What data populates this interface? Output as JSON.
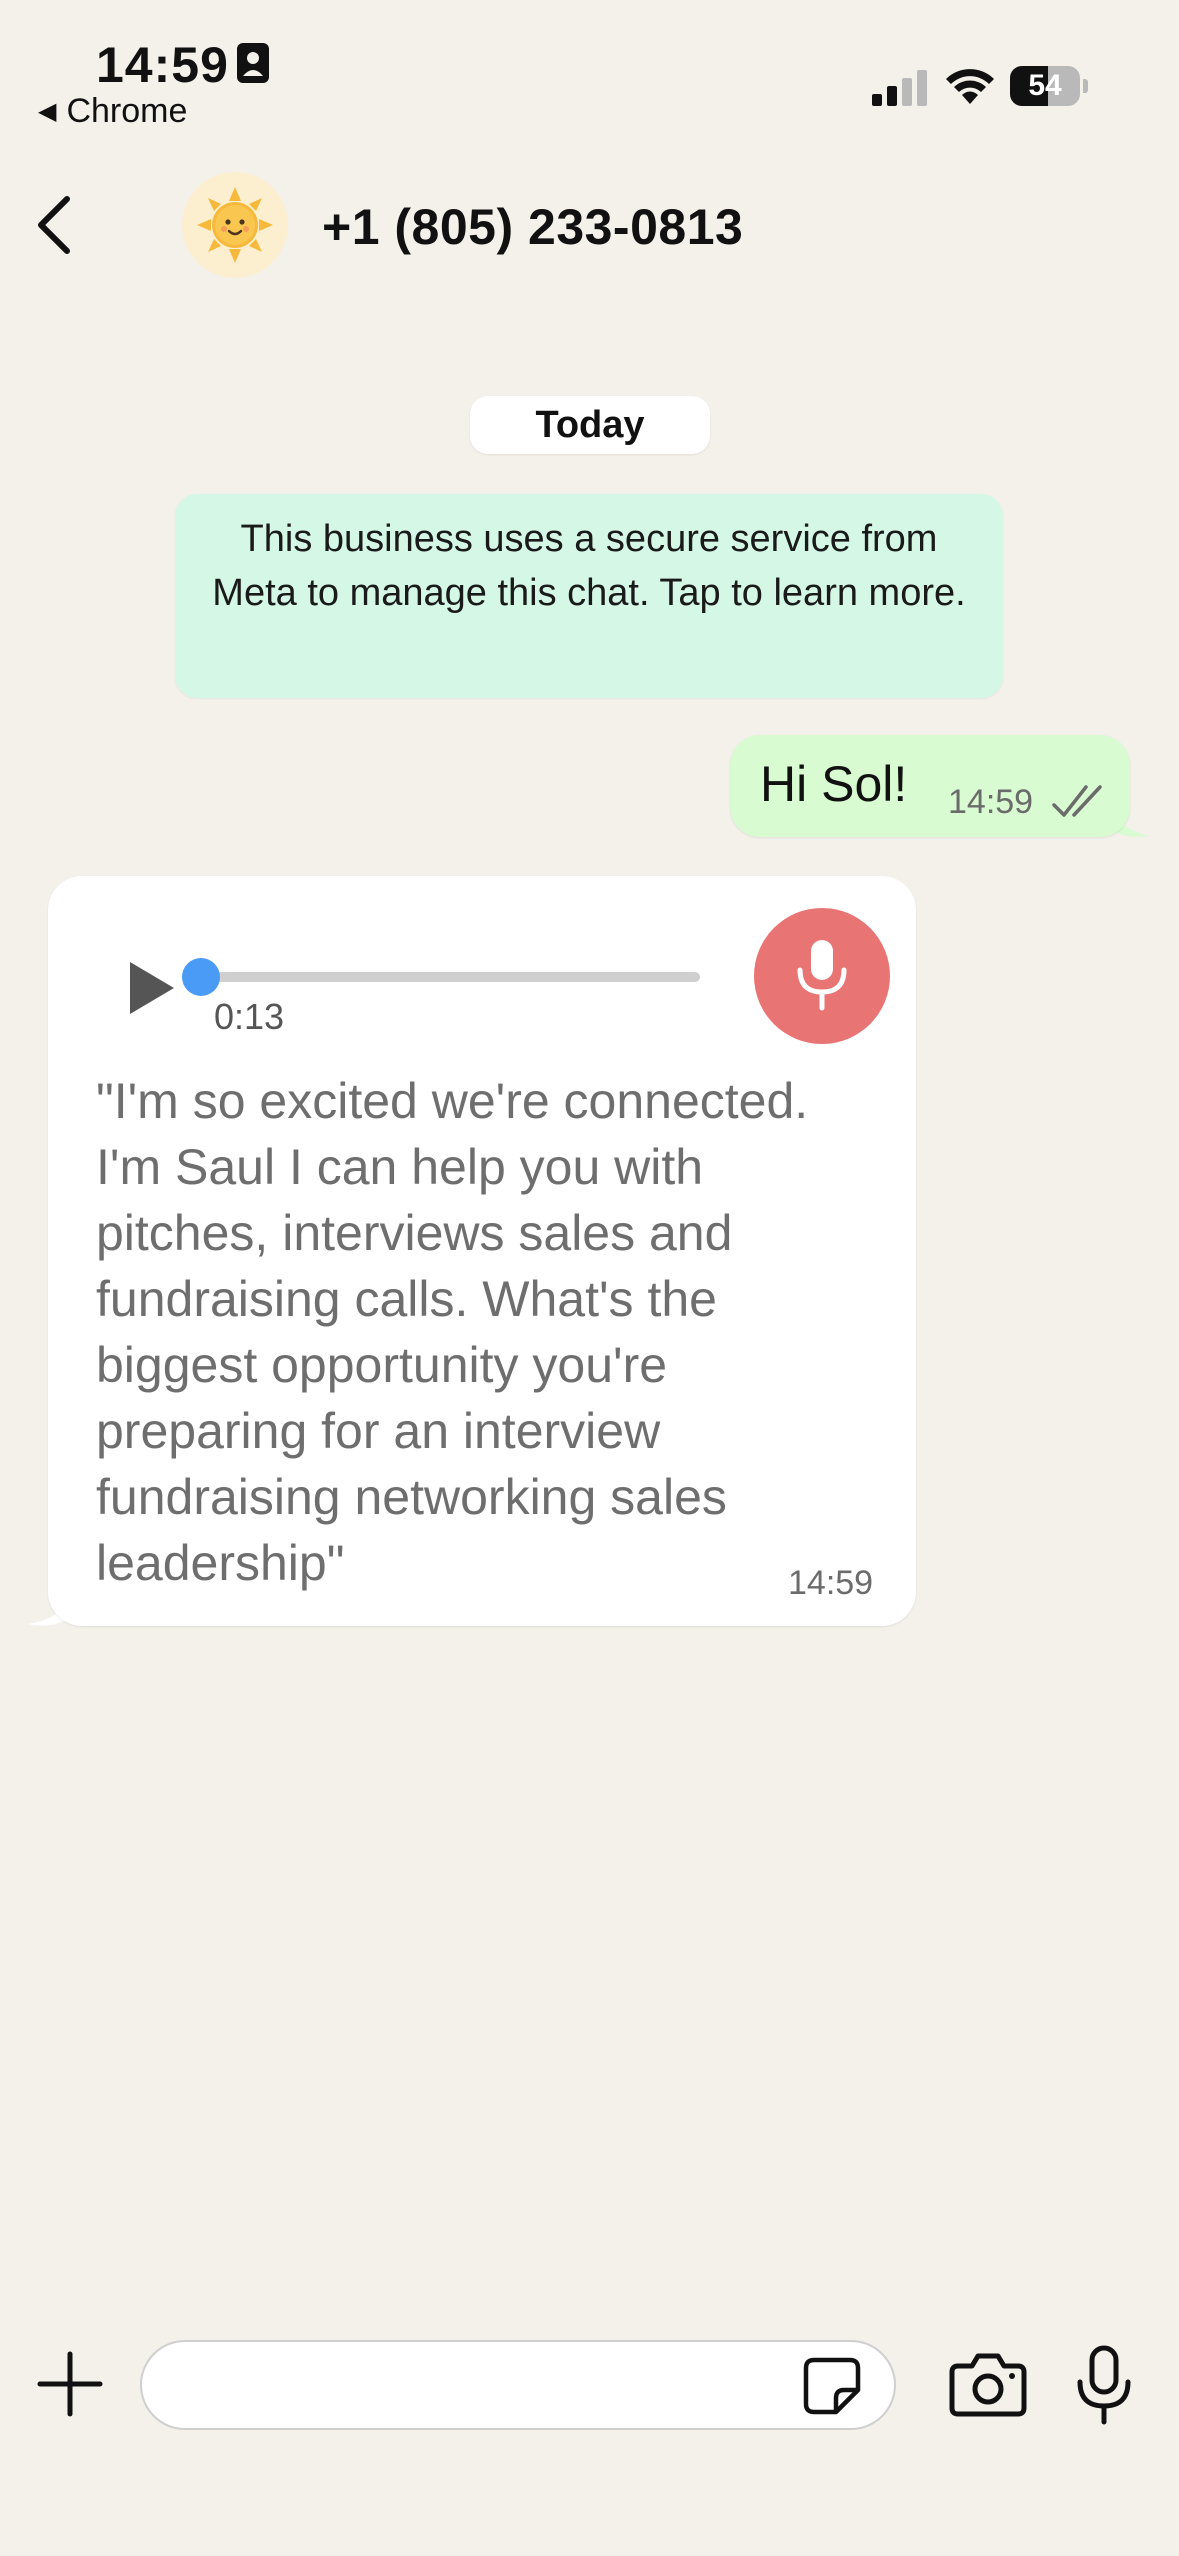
{
  "status_bar": {
    "time": "14:59",
    "back_app": "Chrome",
    "battery_level": "54",
    "battery_percent": 54
  },
  "header": {
    "contact_name": "+1 (805) 233-0813",
    "avatar_icon": "sun-emoji-icon"
  },
  "chat": {
    "date_label": "Today",
    "meta_notice": "This business uses a secure service from Meta to manage this chat. Tap to learn more.",
    "outgoing": {
      "text": "Hi Sol!",
      "time": "14:59",
      "status_icon": "double-check-icon"
    },
    "incoming_voice": {
      "duration": "0:13",
      "progress": 0,
      "transcript": "\"I'm so excited we're connected. I'm Saul I can help you with pitches, interviews sales and fundraising calls. What's the biggest opportunity you're preparing for an interview fundraising networking sales leadership\"",
      "time": "14:59"
    }
  },
  "input_bar": {
    "placeholder": "",
    "value": ""
  },
  "colors": {
    "background": "#f4f1eb",
    "outgoing_bubble": "#d8fbd2",
    "meta_notice": "#d5f8e6",
    "voice_badge": "#e97474",
    "progress_knob": "#4a9bf5"
  }
}
